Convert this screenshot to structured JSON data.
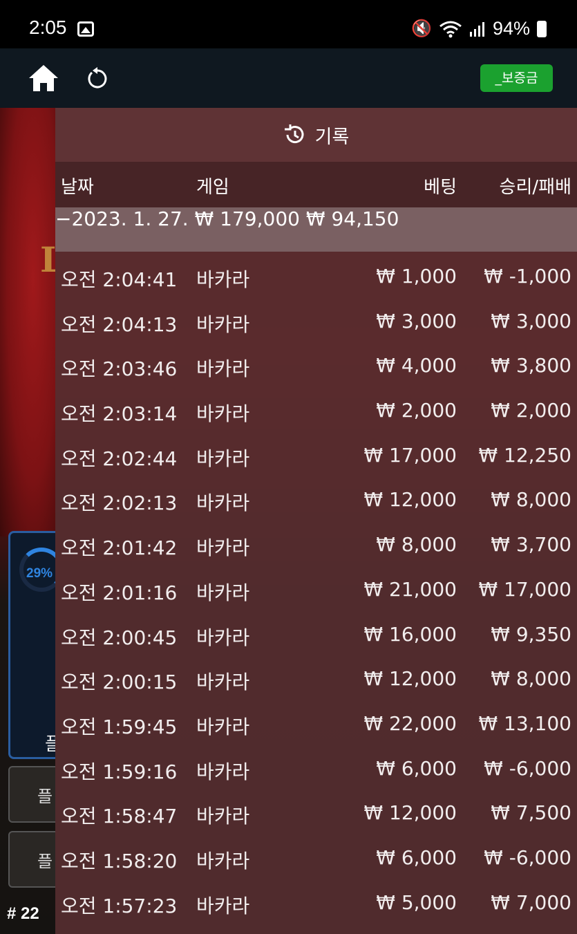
{
  "status_bar": {
    "time": "2:05",
    "battery": "94%"
  },
  "toolbar": {
    "deposit_label": "_보증금"
  },
  "game_background": {
    "progress": "29%",
    "side_label": "플",
    "button_1": "플",
    "button_2": "플",
    "round": "# 22"
  },
  "history": {
    "title": "기록",
    "columns": {
      "date": "날짜",
      "game": "게임",
      "bet": "베팅",
      "win_loss": "승리/패배"
    },
    "summary": {
      "date": "−2023. 1. 27.",
      "bet": "₩ 179,000",
      "win_loss": "₩ 94,150"
    },
    "rows": [
      {
        "time": "오전 2:04:41",
        "game": "바카라",
        "bet": "₩ 1,000",
        "win_loss": "₩ -1,000"
      },
      {
        "time": "오전 2:04:13",
        "game": "바카라",
        "bet": "₩ 3,000",
        "win_loss": "₩ 3,000"
      },
      {
        "time": "오전 2:03:46",
        "game": "바카라",
        "bet": "₩ 4,000",
        "win_loss": "₩ 3,800"
      },
      {
        "time": "오전 2:03:14",
        "game": "바카라",
        "bet": "₩ 2,000",
        "win_loss": "₩ 2,000"
      },
      {
        "time": "오전 2:02:44",
        "game": "바카라",
        "bet": "₩ 17,000",
        "win_loss": "₩ 12,250"
      },
      {
        "time": "오전 2:02:13",
        "game": "바카라",
        "bet": "₩ 12,000",
        "win_loss": "₩ 8,000"
      },
      {
        "time": "오전 2:01:42",
        "game": "바카라",
        "bet": "₩ 8,000",
        "win_loss": "₩ 3,700"
      },
      {
        "time": "오전 2:01:16",
        "game": "바카라",
        "bet": "₩ 21,000",
        "win_loss": "₩ 17,000"
      },
      {
        "time": "오전 2:00:45",
        "game": "바카라",
        "bet": "₩ 16,000",
        "win_loss": "₩ 9,350"
      },
      {
        "time": "오전 2:00:15",
        "game": "바카라",
        "bet": "₩ 12,000",
        "win_loss": "₩ 8,000"
      },
      {
        "time": "오전 1:59:45",
        "game": "바카라",
        "bet": "₩ 22,000",
        "win_loss": "₩ 13,100"
      },
      {
        "time": "오전 1:59:16",
        "game": "바카라",
        "bet": "₩ 6,000",
        "win_loss": "₩ -6,000"
      },
      {
        "time": "오전 1:58:47",
        "game": "바카라",
        "bet": "₩ 12,000",
        "win_loss": "₩ 7,500"
      },
      {
        "time": "오전 1:58:20",
        "game": "바카라",
        "bet": "₩ 6,000",
        "win_loss": "₩ -6,000"
      },
      {
        "time": "오전 1:57:23",
        "game": "바카라",
        "bet": "₩ 5,000",
        "win_loss": "₩ 7,000"
      }
    ]
  }
}
